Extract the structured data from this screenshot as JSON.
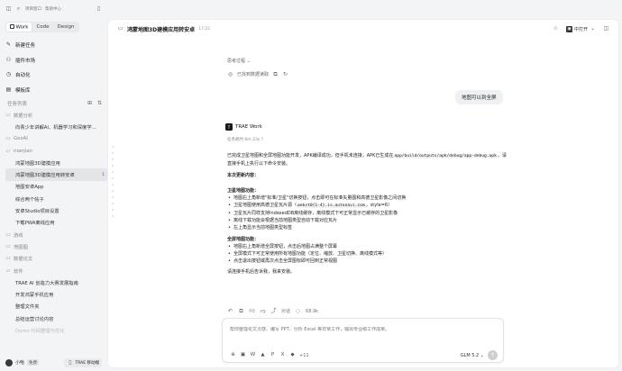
{
  "topbar": {
    "item1": "项目窗口",
    "item2": "帮助中心"
  },
  "modes": [
    {
      "label": "Work"
    },
    {
      "label": "Code"
    },
    {
      "label": "Design"
    }
  ],
  "nav": [
    {
      "label": "新建任务",
      "icon": "edit-icon"
    },
    {
      "label": "插件市场",
      "icon": "plugin-icon"
    },
    {
      "label": "自动化",
      "icon": "automation-icon"
    },
    {
      "label": "模板库",
      "icon": "template-icon"
    }
  ],
  "tasks": {
    "header": "任务列表",
    "rows": [
      {
        "label": "数据分析",
        "type": "group"
      },
      {
        "label": "向青少年讲解AI、机器学习和深度学…",
        "type": "child"
      },
      {
        "label": "GeoAI",
        "type": "group"
      },
      {
        "label": "nianjian",
        "type": "group"
      },
      {
        "label": "鸿蒙地图3D建模应用",
        "type": "child"
      },
      {
        "label": "鸿蒙地图3D建模应用转安卓",
        "type": "selected",
        "badge": "1"
      },
      {
        "label": "地图安卓App",
        "type": "child"
      },
      {
        "label": "综合两个帖子",
        "type": "child"
      },
      {
        "label": "安卓Studio项目设置",
        "type": "child"
      },
      {
        "label": "下载PWA离线应用",
        "type": "child"
      },
      {
        "label": "游戏",
        "type": "group"
      },
      {
        "label": "地图图",
        "type": "group"
      },
      {
        "label": "数据论文",
        "type": "group"
      },
      {
        "label": "软件",
        "type": "group"
      },
      {
        "label": "TRAE AI 创造力大赛发展指南",
        "type": "child"
      },
      {
        "label": "开发鸿蒙手机应用",
        "type": "child"
      },
      {
        "label": "整理文件夹",
        "type": "child"
      },
      {
        "label": "总结运营讨论内容",
        "type": "child"
      },
      {
        "label": "Demo 代码整理与优化",
        "type": "faded"
      }
    ]
  },
  "user": {
    "name": "小哈",
    "plan": "免费",
    "app_button": "TRAE 移动端"
  },
  "chat": {
    "title": "鸿蒙地图3D建模应用转安卓",
    "time": "17:22",
    "open_label": "中打开",
    "thinking": "思考过程",
    "refs_label": "已找到数据读取",
    "user_message": "地图可以到全屏",
    "ai_name": "TRAE Work",
    "ai_time": "任务耗时 6m 23s ?",
    "intro_1": "已完成卫星地图和全屏地图功能开发，APK编译成功，但手机未连接，APK已生成在",
    "intro_code": "app/build/outputs/apk/debug/app-debug.apk",
    "intro_2": "，请直接手机上执行以下命令安装。",
    "updates_heading": "本次更新内容：",
    "sat_heading": "卫星地图功能：",
    "sat_items": [
      "地图右上角新增\"标准/卫星\"切换按钮，点击即可在标准矢量图和高德卫星影像之间切换",
      "卫星地图使用高德卫星瓦片源（",
      "卫星瓦片同样支持IndexedDB离线缓存，离线模式下可正常显示已缓存的卫星影像",
      "离线下载功能会根据当前地图类型自动下载对应瓦片",
      "左上角显示当前地图类型标签"
    ],
    "sat_item2_code": "webst0{1-4}.is.autonavi.com",
    "sat_item2_tail": "，style=6）",
    "full_heading": "全屏地图功能：",
    "full_items": [
      "地图右上角新增全屏按钮，点击后地图占满整个屏幕",
      "全屏模式下可正常使用所有地图功能（定位、缩放、卫星切换、离线模式等）",
      "点击退出按钮或再次点击全屏图标即可回到正常视图"
    ],
    "closing": "请连接手机后告诉我，我来安装。",
    "action_label": "对话",
    "action_count": "68.9k"
  },
  "input": {
    "placeholder": "帮你整理论文灵感、编写 PPT、分析 Excel 等日常工作，输出专业级工作成果。",
    "more_count": "+11",
    "model": "GLM 5.2"
  }
}
